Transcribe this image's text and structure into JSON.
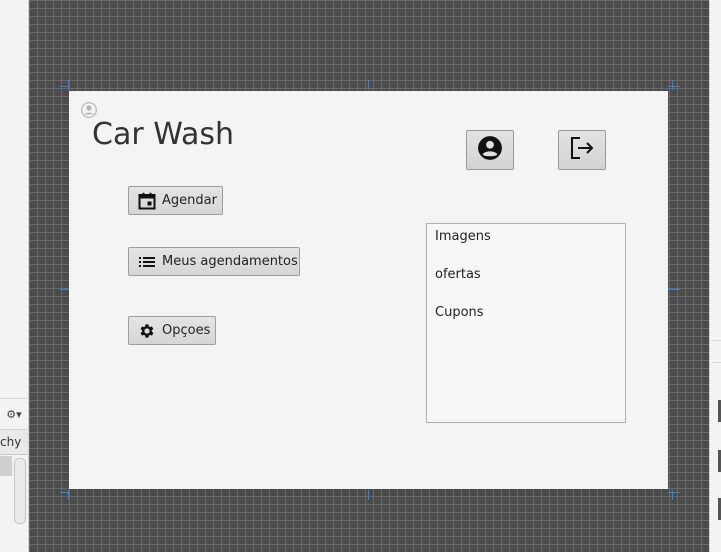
{
  "app": {
    "title": "Car Wash"
  },
  "actions": {
    "schedule_label": "Agendar",
    "my_appointments_label": "Meus agendamentos",
    "options_label": "Opçoes"
  },
  "icons": {
    "avatar": "user-circle-icon",
    "profile": "account-circle-icon",
    "logout": "logout-icon",
    "schedule": "calendar-icon",
    "appointments": "list-icon",
    "options": "gear-icon"
  },
  "menu_list": {
    "items": [
      "Imagens",
      "ofertas",
      "Cupons"
    ]
  },
  "ide": {
    "tab_text": "chy"
  },
  "colors": {
    "canvas": "#4b4b4b",
    "form_background": "#f4f4f4",
    "marker": "#3f7fd6"
  }
}
